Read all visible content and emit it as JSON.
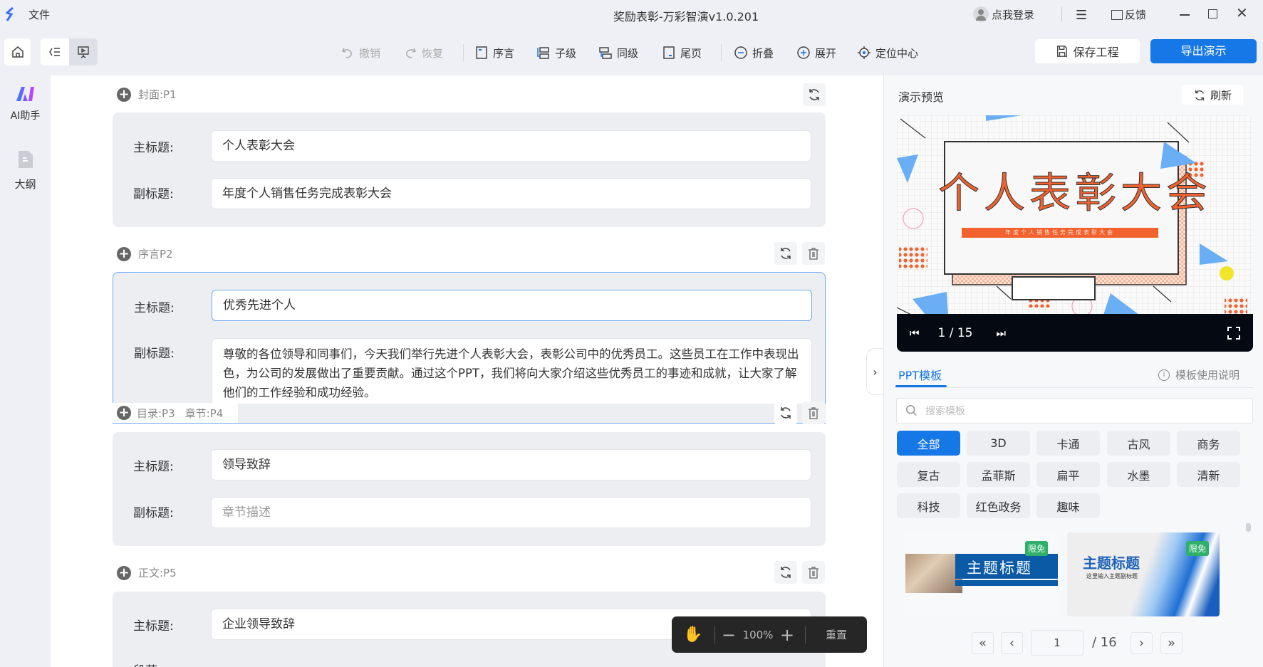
{
  "titlebar": {
    "menu_file": "文件",
    "title": "奖励表彰-万彩智演v1.0.201",
    "login": "点我登录",
    "feedback": "反馈"
  },
  "toolbar": {
    "undo": "撤销",
    "redo": "恢复",
    "preface": "序言",
    "child": "子级",
    "sibling": "同级",
    "ending": "尾页",
    "collapse": "折叠",
    "expand": "展开",
    "locate": "定位中心",
    "save": "保存工程",
    "export": "导出演示"
  },
  "sidebar": {
    "items": [
      {
        "label": "AI助手",
        "icon": "ai-icon"
      },
      {
        "label": "大纲",
        "icon": "outline-doc-icon"
      }
    ]
  },
  "editor": {
    "sections": [
      {
        "header": "封面:P1",
        "main_label": "主标题:",
        "main_value": "个人表彰大会",
        "sub_label": "副标题:",
        "sub_value": "年度个人销售任务完成表彰大会"
      },
      {
        "header": "序言P2",
        "main_label": "主标题:",
        "main_value": "优秀先进个人",
        "sub_label": "副标题:",
        "sub_value": "尊敬的各位领导和同事们，今天我们举行先进个人表彰大会，表彰公司中的优秀员工。这些员工在工作中表现出色，为公司的发展做出了重要贡献。通过这个PPT，我们将向大家介绍这些优秀员工的事迹和成就，让大家了解他们的工作经验和成功经验。"
      },
      {
        "header_a": "目录:P3",
        "header_b": "章节:P4",
        "main_label": "主标题:",
        "main_value": "领导致辞",
        "sub_label": "副标题:",
        "sub_placeholder": "章节描述"
      },
      {
        "header": "正文:P5",
        "main_label": "主标题:",
        "main_value": "企业领导致辞",
        "para_label": "段落:"
      }
    ],
    "zoom": {
      "level": "100%",
      "reset": "重置"
    }
  },
  "preview": {
    "title": "演示预览",
    "refresh": "刷新",
    "slide_title": "个人表彰大会",
    "slide_subtitle": "年度个人销售任务完成表彰大会",
    "counter": "1 / 15"
  },
  "templates": {
    "tab": "PPT模板",
    "help": "模板使用说明",
    "search_placeholder": "搜索模板",
    "categories": [
      "全部",
      "3D",
      "卡通",
      "古风",
      "商务",
      "复古",
      "孟菲斯",
      "扁平",
      "水墨",
      "清新",
      "科技",
      "红色政务",
      "趣味"
    ],
    "selected": "全部",
    "cards": [
      {
        "title": "主题标题",
        "badge": "限免"
      },
      {
        "title": "主题标题",
        "subtitle": "这里输入主题副标题",
        "badge": "限免"
      }
    ],
    "page": "1",
    "total": "/ 16"
  },
  "colors": {
    "accent": "#1677e6",
    "badge": "#2fb06a",
    "slide_orange": "#f2622e",
    "slide_blue": "#6aaef5"
  }
}
